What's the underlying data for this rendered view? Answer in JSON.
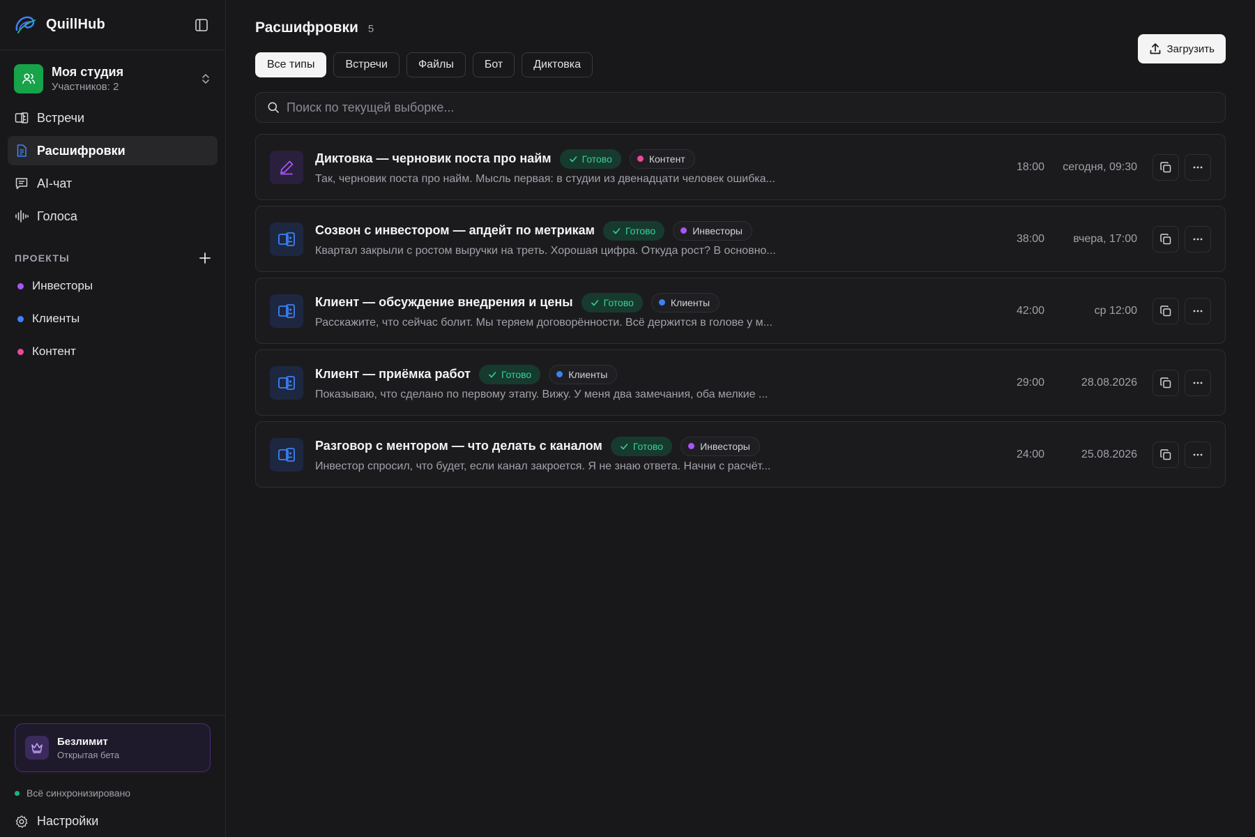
{
  "brand": {
    "name": "QuillHub",
    "logo_icon": "swirl-logo-icon"
  },
  "workspace": {
    "name": "Моя студия",
    "members": "Участников: 2"
  },
  "nav": [
    {
      "label": "Встречи",
      "icon": "meetings-icon",
      "active": false
    },
    {
      "label": "Расшифровки",
      "icon": "document-icon",
      "active": true
    },
    {
      "label": "AI-чат",
      "icon": "chat-icon",
      "active": false
    },
    {
      "label": "Голоса",
      "icon": "waveform-icon",
      "active": false
    }
  ],
  "projects": {
    "title": "ПРОЕКТЫ",
    "items": [
      {
        "label": "Инвесторы",
        "color": "#a855f7"
      },
      {
        "label": "Клиенты",
        "color": "#3b82f6"
      },
      {
        "label": "Контент",
        "color": "#ec4899"
      }
    ]
  },
  "plan": {
    "title": "Безлимит",
    "subtitle": "Открытая бета"
  },
  "sync_status": {
    "label": "Всё синхронизировано",
    "color": "#10b981"
  },
  "settings_label": "Настройки",
  "page": {
    "title": "Расшифровки",
    "count": "5",
    "upload_label": "Загрузить"
  },
  "filters": [
    {
      "label": "Все типы",
      "active": true
    },
    {
      "label": "Встречи",
      "active": false
    },
    {
      "label": "Файлы",
      "active": false
    },
    {
      "label": "Бот",
      "active": false
    },
    {
      "label": "Диктовка",
      "active": false
    }
  ],
  "search": {
    "placeholder": "Поиск по текущей выборке..."
  },
  "status_label": "Готово",
  "transcripts": [
    {
      "title": "Диктовка — черновик поста про найм",
      "project": "Контент",
      "project_color": "#ec4899",
      "kind": "dictation",
      "preview": "Так, черновик поста про найм. Мысль первая: в студии из двенадцати человек ошибка...",
      "duration": "18:00",
      "date": "сегодня, 09:30"
    },
    {
      "title": "Созвон с инвестором — апдейт по метрикам",
      "project": "Инвесторы",
      "project_color": "#a855f7",
      "kind": "meeting",
      "preview": "Квартал закрыли с ростом выручки на треть. Хорошая цифра. Откуда рост? В основно...",
      "duration": "38:00",
      "date": "вчера, 17:00"
    },
    {
      "title": "Клиент — обсуждение внедрения и цены",
      "project": "Клиенты",
      "project_color": "#3b82f6",
      "kind": "meeting",
      "preview": "Расскажите, что сейчас болит. Мы теряем договорённости. Всё держится в голове у м...",
      "duration": "42:00",
      "date": "ср 12:00"
    },
    {
      "title": "Клиент — приёмка работ",
      "project": "Клиенты",
      "project_color": "#3b82f6",
      "kind": "meeting",
      "preview": "Показываю, что сделано по первому этапу. Вижу. У меня два замечания, оба мелкие ...",
      "duration": "29:00",
      "date": "28.08.2026"
    },
    {
      "title": "Разговор с ментором — что делать с каналом",
      "project": "Инвесторы",
      "project_color": "#a855f7",
      "kind": "meeting",
      "preview": "Инвестор спросил, что будет, если канал закроется. Я не знаю ответа. Начни с расчёт...",
      "duration": "24:00",
      "date": "25.08.2026"
    }
  ]
}
